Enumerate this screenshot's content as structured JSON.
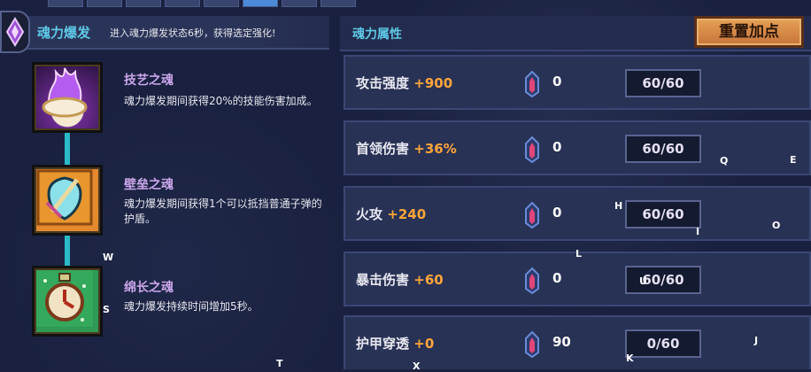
{
  "left_panel": {
    "title": "魂力爆发",
    "description": "进入魂力爆发状态6秒，获得选定强化!",
    "souls": [
      {
        "name": "技艺之魂",
        "description": "魂力爆发期间获得20%的技能伤害加成。",
        "icon": "flame-crystal-icon"
      },
      {
        "name": "壁垒之魂",
        "description": "魂力爆发期间获得1个可以抵挡普通子弹的护盾。",
        "icon": "shield-icon"
      },
      {
        "name": "绵长之魂",
        "description": "魂力爆发持续时间增加5秒。",
        "icon": "stopwatch-icon"
      }
    ]
  },
  "right_panel": {
    "title": "魂力属性",
    "reset_button": "重置加点",
    "stats": [
      {
        "label": "攻击强度",
        "bonus": "+900",
        "stones": "0",
        "level": "60/60"
      },
      {
        "label": "首领伤害",
        "bonus": "+36%",
        "stones": "0",
        "level": "60/60"
      },
      {
        "label": "火攻",
        "bonus": "+240",
        "stones": "0",
        "level": "60/60"
      },
      {
        "label": "暴击伤害",
        "bonus": "+60",
        "stones": "0",
        "level": "60/60"
      },
      {
        "label": "护甲穿透",
        "bonus": "+0",
        "stones": "90",
        "level": "0/60"
      }
    ]
  },
  "hotkeys": [
    "Q",
    "E",
    "H",
    "I",
    "O",
    "W",
    "L",
    "S",
    "U",
    "J",
    "T",
    "K",
    "X"
  ],
  "colors": {
    "accent_cyan": "#5ec8e6",
    "bonus_orange": "#ffa53a",
    "soul_name_purple": "#c9a6e8",
    "button_orange": "#e6a155"
  }
}
